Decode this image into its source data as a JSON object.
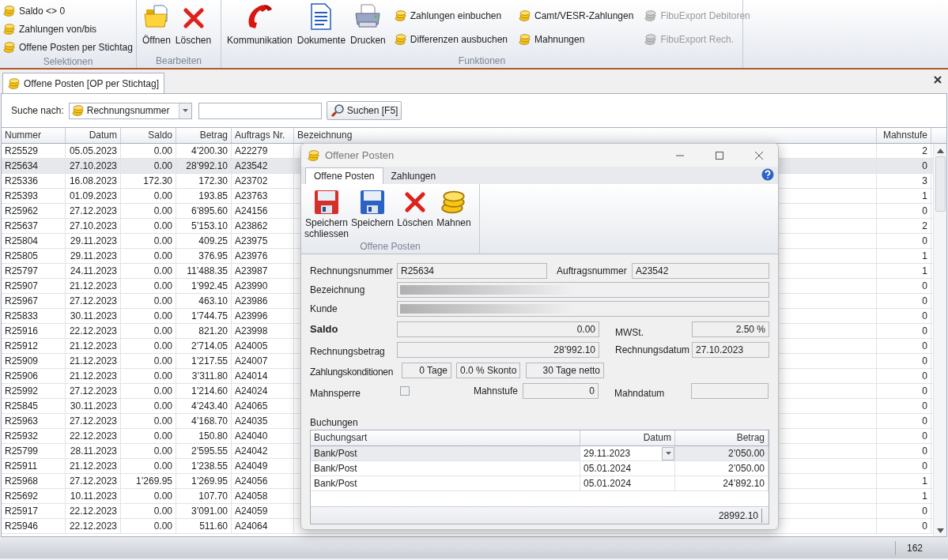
{
  "ribbon": {
    "groups": [
      {
        "label": "Selektionen",
        "small": [
          {
            "label": "Saldo <> 0",
            "disabled": false
          },
          {
            "label": "Zahlungen von/bis",
            "disabled": false
          },
          {
            "label": "Offene Posten per Stichtag",
            "disabled": false
          }
        ]
      },
      {
        "label": "Bearbeiten",
        "large": [
          "Öffnen",
          "Löschen"
        ]
      },
      {
        "label": "Funktionen",
        "large": [
          "Kommunikation",
          "Dokumente",
          "Drucken"
        ],
        "small": [
          {
            "label": "Zahlungen einbuchen",
            "disabled": false
          },
          {
            "label": "Differenzen ausbuchen",
            "disabled": false
          },
          {
            "label": "Camt/VESR-Zahlungen",
            "disabled": false
          },
          {
            "label": "Mahnungen",
            "disabled": false
          },
          {
            "label": "FibuExport Debitoren",
            "disabled": true
          },
          {
            "label": "FibuExport Rech.",
            "disabled": true
          }
        ]
      }
    ]
  },
  "tabs": [
    {
      "label": "Offene Posten [OP per Stichtag]",
      "selected": true
    }
  ],
  "search": {
    "label": "Suche nach:",
    "field": "Rechnungsnummer",
    "button": "Suchen [F5]"
  },
  "table": {
    "columns": [
      "Nummer",
      "Datum",
      "Saldo",
      "Betrag",
      "Auftrags Nr.",
      "Bezeichnung",
      "Mahnstufe"
    ],
    "rows": [
      {
        "cells": [
          "R25529",
          "05.05.2023",
          "0.00",
          "4’200.30",
          "A22279",
          "2"
        ],
        "selected": false
      },
      {
        "cells": [
          "R25634",
          "27.10.2023",
          "0.00",
          "28’992.10",
          "A23542",
          "0"
        ],
        "selected": true
      },
      {
        "cells": [
          "R25336",
          "16.08.2023",
          "172.30",
          "172.30",
          "A23702",
          "3"
        ],
        "selected": false
      },
      {
        "cells": [
          "R25393",
          "01.09.2023",
          "0.00",
          "193.85",
          "A23763",
          "1"
        ],
        "selected": false
      },
      {
        "cells": [
          "R25962",
          "27.12.2023",
          "0.00",
          "6’895.60",
          "A24156",
          "0"
        ],
        "selected": false
      },
      {
        "cells": [
          "R25637",
          "27.10.2023",
          "0.00",
          "5’153.10",
          "A23862",
          "2"
        ],
        "selected": false
      },
      {
        "cells": [
          "R25804",
          "29.11.2023",
          "0.00",
          "409.25",
          "A23975",
          "0"
        ],
        "selected": false
      },
      {
        "cells": [
          "R25805",
          "29.11.2023",
          "0.00",
          "376.95",
          "A23976",
          "1"
        ],
        "selected": false
      },
      {
        "cells": [
          "R25797",
          "24.11.2023",
          "0.00",
          "11’488.35",
          "A23987",
          "1"
        ],
        "selected": false
      },
      {
        "cells": [
          "R25907",
          "21.12.2023",
          "0.00",
          "1’992.45",
          "A23990",
          "0"
        ],
        "selected": false
      },
      {
        "cells": [
          "R25967",
          "27.12.2023",
          "0.00",
          "463.10",
          "A23986",
          "0"
        ],
        "selected": false
      },
      {
        "cells": [
          "R25833",
          "30.11.2023",
          "0.00",
          "1’744.75",
          "A23996",
          "0"
        ],
        "selected": false
      },
      {
        "cells": [
          "R25916",
          "22.12.2023",
          "0.00",
          "821.20",
          "A23998",
          "0"
        ],
        "selected": false
      },
      {
        "cells": [
          "R25912",
          "21.12.2023",
          "0.00",
          "2’714.05",
          "A24005",
          "0"
        ],
        "selected": false
      },
      {
        "cells": [
          "R25909",
          "21.12.2023",
          "0.00",
          "1’217.55",
          "A24007",
          "0"
        ],
        "selected": false
      },
      {
        "cells": [
          "R25906",
          "21.12.2023",
          "0.00",
          "3’311.80",
          "A24014",
          "0"
        ],
        "selected": false
      },
      {
        "cells": [
          "R25992",
          "27.12.2023",
          "0.00",
          "1’214.60",
          "A24024",
          "0"
        ],
        "selected": false
      },
      {
        "cells": [
          "R25845",
          "30.11.2023",
          "0.00",
          "4’243.40",
          "A24065",
          "0"
        ],
        "selected": false
      },
      {
        "cells": [
          "R25963",
          "27.12.2023",
          "0.00",
          "4’168.70",
          "A24035",
          "0"
        ],
        "selected": false
      },
      {
        "cells": [
          "R25932",
          "22.12.2023",
          "0.00",
          "150.80",
          "A24040",
          "0"
        ],
        "selected": false
      },
      {
        "cells": [
          "R25799",
          "28.11.2023",
          "0.00",
          "2’595.55",
          "A24042",
          "0"
        ],
        "selected": false
      },
      {
        "cells": [
          "R25911",
          "21.12.2023",
          "0.00",
          "1’238.55",
          "A24049",
          "0"
        ],
        "selected": false
      },
      {
        "cells": [
          "R25968",
          "27.12.2023",
          "1’269.95",
          "1’269.95",
          "A24056",
          "1"
        ],
        "selected": false
      },
      {
        "cells": [
          "R25692",
          "10.11.2023",
          "0.00",
          "107.70",
          "A24058",
          "1"
        ],
        "selected": false
      },
      {
        "cells": [
          "R25917",
          "22.12.2023",
          "0.00",
          "3’091.00",
          "A24059",
          "0"
        ],
        "selected": false
      },
      {
        "cells": [
          "R25946",
          "22.12.2023",
          "0.00",
          "511.60",
          "A24064",
          "0"
        ],
        "selected": false
      }
    ]
  },
  "status_bar": {
    "count": "162"
  },
  "dialog": {
    "title": "Offener Posten",
    "tabs": [
      {
        "label": "Offene Posten",
        "selected": true
      },
      {
        "label": "Zahlungen",
        "selected": false
      }
    ],
    "buttons": [
      "Speichern schliessen",
      "Speichern",
      "Löschen",
      "Mahnen"
    ],
    "group_label": "Offene Posten",
    "fields": {
      "rechnungsnummer": {
        "label": "Rechnungsnummer",
        "value": "R25634"
      },
      "auftragsnummer": {
        "label": "Auftragsnummer",
        "value": "A23542"
      },
      "bezeichnung": {
        "label": "Bezeichnung"
      },
      "kunde": {
        "label": "Kunde"
      },
      "saldo": {
        "label": "Saldo",
        "value": "0.00"
      },
      "mwst": {
        "label": "MWSt.",
        "value": "2.50 %"
      },
      "rechnungsbetrag": {
        "label": "Rechnungsbetrag",
        "value": "28’992.10"
      },
      "rechnungsdatum": {
        "label": "Rechnungsdatum",
        "value": "27.10.2023"
      },
      "zahlungskonditionen": {
        "label": "Zahlungskonditionen",
        "values": [
          "0 Tage",
          "0.0 % Skonto",
          "30 Tage netto"
        ]
      },
      "mahnsperre": {
        "label": "Mahnsperre",
        "checked": false
      },
      "mahnstufe": {
        "label": "Mahnstufe",
        "value": "0"
      },
      "mahndatum": {
        "label": "Mahndatum"
      }
    },
    "buchungen": {
      "label": "Buchungen",
      "columns": [
        "Buchungsart",
        "Datum",
        "Betrag"
      ],
      "rows": [
        {
          "cells": [
            "Bank/Post",
            "29.11.2023",
            "2’050.00"
          ],
          "selected": true
        },
        {
          "cells": [
            "Bank/Post",
            "05.01.2024",
            "2’050.00"
          ],
          "selected": false
        },
        {
          "cells": [
            "Bank/Post",
            "05.01.2024",
            "24’892.10"
          ],
          "selected": false
        }
      ],
      "total": "28992.10"
    }
  }
}
